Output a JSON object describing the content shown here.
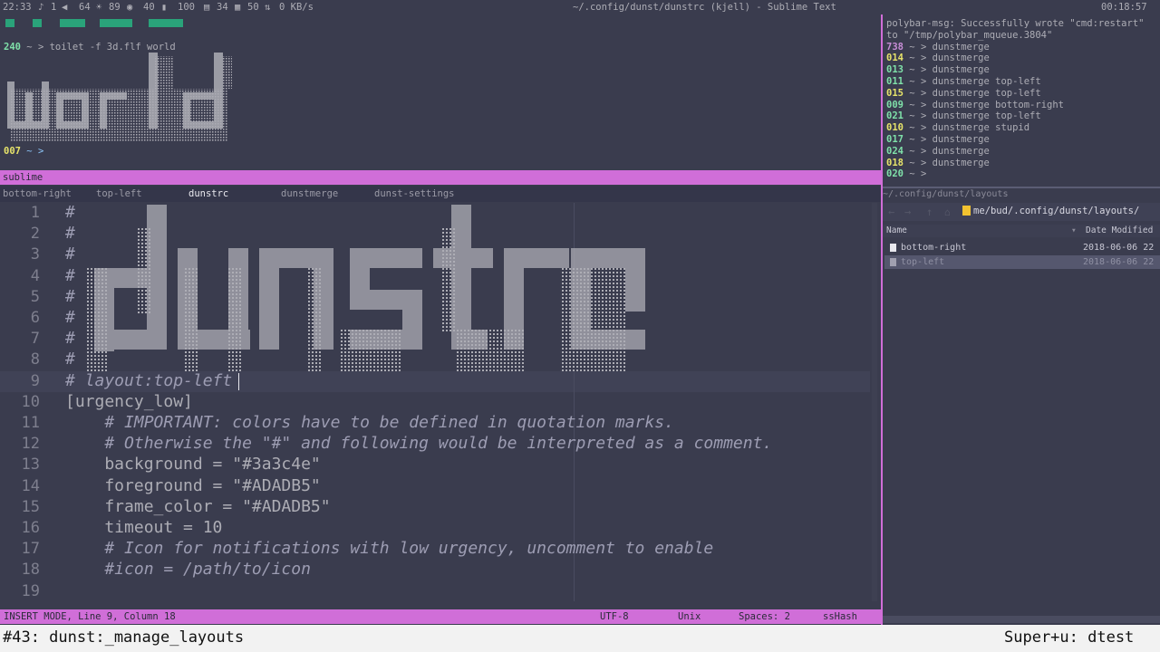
{
  "polybar": {
    "time_left": "22:33",
    "notif_icon": "bell-icon",
    "notif_count": "1",
    "volume_icon": "speaker-icon",
    "volume": "64",
    "brightness_icon": "sun-icon",
    "brightness": "89",
    "eye_icon": "eye-icon",
    "eye_value": "40",
    "battery_icon": "battery-icon",
    "battery": "100",
    "memory_icon": "memory-icon",
    "memory": "34",
    "disk_icon": "disk-icon",
    "disk": "50",
    "network_icon": "network-icon",
    "network": "0 KB/s",
    "window_title": "~/.config/dunst/dunstrc (kjell) - Sublime Text",
    "time_right": "00:18:57"
  },
  "term_left": {
    "command_prompt_num": "240",
    "command": "~ > toilet -f 3d.flf world",
    "ascii_word": "world",
    "second_prompt_num": "007",
    "second_prompt": "~ >"
  },
  "term_right": {
    "line1": "polybar-msg: Successfully wrote \"cmd:restart\"",
    "line2": "to \"/tmp/polybar_mqueue.3804\"",
    "history": [
      {
        "num": "738",
        "cmd": "~ > dunstmerge"
      },
      {
        "num": "014",
        "cmd": "~ > dunstmerge"
      },
      {
        "num": "013",
        "cmd": "~ > dunstmerge"
      },
      {
        "num": "011",
        "cmd": "~ > dunstmerge top-left"
      },
      {
        "num": "015",
        "cmd": "~ > dunstmerge top-left"
      },
      {
        "num": "009",
        "cmd": "~ > dunstmerge bottom-right"
      },
      {
        "num": "021",
        "cmd": "~ > dunstmerge top-left"
      },
      {
        "num": "010",
        "cmd": "~ > dunstmerge stupid"
      },
      {
        "num": "017",
        "cmd": "~ > dunstmerge"
      },
      {
        "num": "024",
        "cmd": "~ > dunstmerge"
      },
      {
        "num": "018",
        "cmd": "~ > dunstmerge"
      },
      {
        "num": "020",
        "cmd": "~ >"
      }
    ]
  },
  "sublime": {
    "window_label": "sublime",
    "tabs": [
      "bottom-right",
      "top-left",
      "dunstrc",
      "dunstmerge",
      "dunst-settings"
    ],
    "active_tab": "dunstrc",
    "ascii_banner": "dunstrc",
    "lines": [
      {
        "n": "1",
        "text": "#"
      },
      {
        "n": "2",
        "text": "#"
      },
      {
        "n": "3",
        "text": "#"
      },
      {
        "n": "4",
        "text": "#"
      },
      {
        "n": "5",
        "text": "#"
      },
      {
        "n": "6",
        "text": "#"
      },
      {
        "n": "7",
        "text": "#"
      },
      {
        "n": "8",
        "text": "#"
      },
      {
        "n": "9",
        "text": "# layout:top-left"
      },
      {
        "n": "10",
        "text": "[urgency_low]"
      },
      {
        "n": "11",
        "text": "    # IMPORTANT: colors have to be defined in quotation marks."
      },
      {
        "n": "12",
        "text": "    # Otherwise the \"#\" and following would be interpreted as a comment."
      },
      {
        "n": "13",
        "text": "    background = \"#3a3c4e\""
      },
      {
        "n": "14",
        "text": "    foreground = \"#ADADB5\""
      },
      {
        "n": "15",
        "text": "    frame_color = \"#ADADB5\""
      },
      {
        "n": "16",
        "text": "    timeout = 10"
      },
      {
        "n": "17",
        "text": "    # Icon for notifications with low urgency, uncomment to enable"
      },
      {
        "n": "18",
        "text": "    #icon = /path/to/icon"
      },
      {
        "n": "19",
        "text": ""
      }
    ],
    "status": {
      "mode": "INSERT MODE, Line 9, Column 18",
      "encoding": "UTF-8",
      "line_endings": "Unix",
      "indent": "Spaces: 2",
      "plugin": "ssHash"
    }
  },
  "file_manager": {
    "title": "~/.config/dunst/layouts",
    "path": "me/bud/.config/dunst/layouts/",
    "columns": {
      "name": "Name",
      "date": "Date Modified"
    },
    "files": [
      {
        "name": "bottom-right",
        "date": "2018-06-06 22"
      },
      {
        "name": "top-left",
        "date": "2018-06-06 22"
      }
    ]
  },
  "cmdline": {
    "left": "#43: dunst:_manage_layouts",
    "right": "Super+u: dtest"
  },
  "colors": {
    "background": "#3a3c4e",
    "foreground": "#ADADB5",
    "accent": "#d06ed8"
  }
}
